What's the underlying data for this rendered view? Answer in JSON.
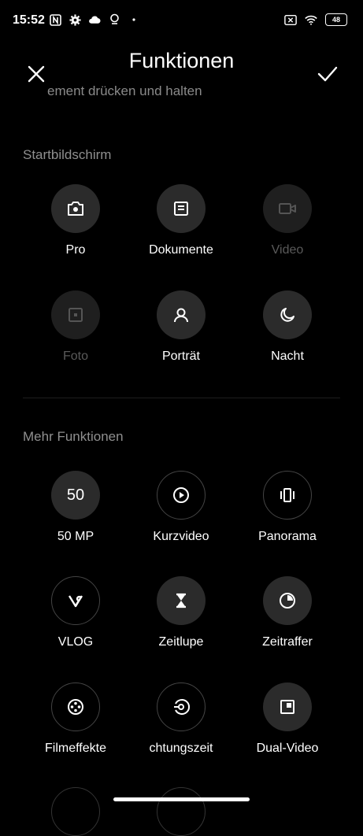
{
  "status": {
    "time": "15:52",
    "battery": "48"
  },
  "header": {
    "title": "Funktionen",
    "subtitle": "ement drücken und halten"
  },
  "sections": {
    "home": {
      "title": "Startbildschirm",
      "items": [
        {
          "label": "Pro",
          "icon": "camera-icon"
        },
        {
          "label": "Dokumente",
          "icon": "document-icon"
        },
        {
          "label": "Video",
          "icon": "video-icon"
        },
        {
          "label": "Foto",
          "icon": "photo-icon"
        },
        {
          "label": "Porträt",
          "icon": "person-icon"
        },
        {
          "label": "Nacht",
          "icon": "moon-icon"
        }
      ]
    },
    "more": {
      "title": "Mehr Funktionen",
      "items": [
        {
          "label": "50 MP",
          "icon_text": "50"
        },
        {
          "label": "Kurzvideo",
          "icon": "play-icon"
        },
        {
          "label": "Panorama",
          "icon": "panorama-icon"
        },
        {
          "label": "VLOG",
          "icon": "vlog-icon"
        },
        {
          "label": "Zeitlupe",
          "icon": "hourglass-icon"
        },
        {
          "label": "Zeitraffer",
          "icon": "timer-icon"
        },
        {
          "label": "Filmeffekte",
          "icon": "film-reel-icon"
        },
        {
          "label": "chtungszeit",
          "icon": "exposure-icon"
        },
        {
          "label": "Dual-Video",
          "icon": "dual-video-icon"
        }
      ]
    }
  }
}
